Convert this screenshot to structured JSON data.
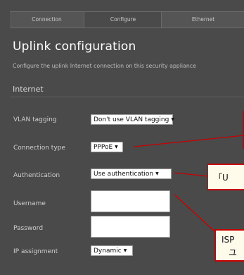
{
  "tabs": [
    {
      "label": "Connection"
    },
    {
      "label": "Configure"
    },
    {
      "label": "Ethernet"
    }
  ],
  "page": {
    "title": "Uplink configuration",
    "subtitle": "Configure the uplink Internet connection on this security appliance"
  },
  "section": {
    "title": "Internet"
  },
  "fields": {
    "vlan_tagging": {
      "label": "VLAN tagging",
      "value": "Don't use VLAN tagging"
    },
    "connection_type": {
      "label": "Connection type",
      "value": "PPPoE"
    },
    "authentication": {
      "label": "Authentication",
      "value": "Use authentication"
    },
    "username": {
      "label": "Username",
      "value": ""
    },
    "password": {
      "label": "Password",
      "value": ""
    },
    "ip_assignment": {
      "label": "IP assignment",
      "value": "Dynamic"
    }
  },
  "callouts": {
    "authentication": "「U",
    "isp_line1": "ISP",
    "isp_line2": "ユ"
  },
  "icons": {
    "dropdown": "triangle-down"
  },
  "colors": {
    "panel": "#4a4a4a",
    "callout_border": "#c80000",
    "callout_fill": "#fffbea"
  }
}
